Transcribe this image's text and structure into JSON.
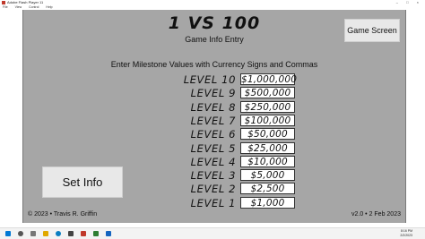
{
  "window": {
    "title": "Adobe Flash Player 11",
    "controls": "– □ ×"
  },
  "menu": [
    "File",
    "View",
    "Control",
    "Help"
  ],
  "game": {
    "title": "1 VS 100",
    "subtitle": "Game Info Entry",
    "game_screen_button": "Game Screen",
    "instructions": "Enter Milestone Values with Currency Signs and Commas",
    "levels": [
      {
        "label": "LEVEL 10",
        "value": "$1,000,000"
      },
      {
        "label": "LEVEL 9",
        "value": "$500,000"
      },
      {
        "label": "LEVEL 8",
        "value": "$250,000"
      },
      {
        "label": "LEVEL 7",
        "value": "$100,000"
      },
      {
        "label": "LEVEL 6",
        "value": "$50,000"
      },
      {
        "label": "LEVEL 5",
        "value": "$25,000"
      },
      {
        "label": "LEVEL 4",
        "value": "$10,000"
      },
      {
        "label": "LEVEL 3",
        "value": "$5,000"
      },
      {
        "label": "LEVEL 2",
        "value": "$2,500"
      },
      {
        "label": "LEVEL 1",
        "value": "$1,000"
      }
    ],
    "set_info_button": "Set Info",
    "copyright": "© 2023 • Travis R. Griffin",
    "version": "v2.0 • 2 Feb 2023"
  },
  "taskbar": {
    "icons": [
      "windows-start-icon",
      "search-icon",
      "task-view-icon",
      "file-explorer-icon",
      "edge-browser-icon",
      "store-icon",
      "flash-player-icon",
      "app-icon",
      "mail-icon"
    ],
    "colors": {
      "accent": "#0078d4",
      "flash": "#c0392b"
    },
    "time": "8:16 PM",
    "date": "2/2/2023"
  }
}
